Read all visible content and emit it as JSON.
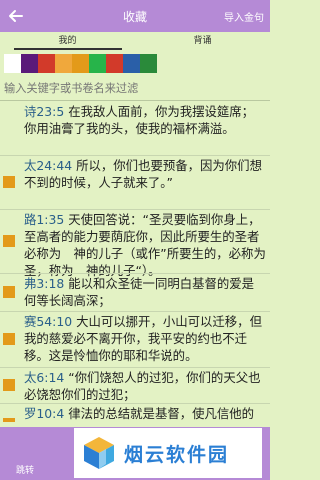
{
  "header": {
    "title": "收藏",
    "import_label": "导入金句"
  },
  "tabs": [
    {
      "label": "我的"
    },
    {
      "label": "背诵"
    }
  ],
  "colors": {
    "header": "#b58ad6",
    "background": "#e3f2c4",
    "reference": "#2a5f8a",
    "marker": "#e39a1a",
    "swatches": [
      "#ffffff",
      "#5a1a7a",
      "#d23a2a",
      "#f0a83c",
      "#e39a1a",
      "#27b44a",
      "#d23a2a",
      "#2a5fa8",
      "#2a8a3a"
    ]
  },
  "search": {
    "placeholder": "输入关键字或书卷名来过滤"
  },
  "verses": [
    {
      "ref": "诗23:5",
      "text": "在我敌人面前，你为我摆设筵席；你用油膏了我的头，使我的福杯满溢。",
      "marked": false
    },
    {
      "ref": "太24:44",
      "text": "所以，你们也要预备，因为你们想不到的时候，人子就来了。”",
      "marked": true
    },
    {
      "ref": "路1:35",
      "text": "天使回答说：“圣灵要临到你身上，至高者的能力要荫庇你，因此所要生的圣者必称为　神的儿子（或作”所要生的，必称为圣，称为　神的儿子“）。",
      "marked": true
    },
    {
      "ref": "弗3:18",
      "text": "能以和众圣徒一同明白基督的爱是何等长阔高深；",
      "marked": true
    },
    {
      "ref": "赛54:10",
      "text": "大山可以挪开，小山可以迁移，但我的慈爱必不离开你，我平安的约也不迁移。这是怜恤你的耶和华说的。",
      "marked": true
    },
    {
      "ref": "太6:14",
      "text": "“你们饶恕人的过犯，你们的天父也必饶恕你们的过犯；",
      "marked": true
    },
    {
      "ref": "罗10:4",
      "text": "律法的总结就是基督，使凡信他的都得着义。",
      "marked": true
    }
  ],
  "footer": {
    "jump_label": "跳转"
  },
  "watermark": {
    "brand": "烟云软件园"
  }
}
